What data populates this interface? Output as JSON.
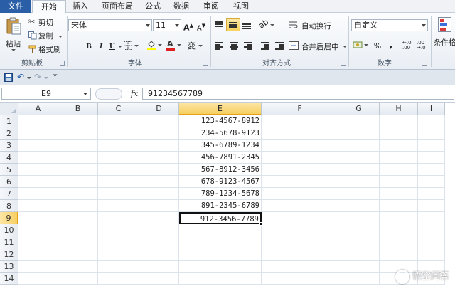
{
  "tabs": {
    "file": "文件",
    "home": "开始",
    "insert": "插入",
    "layout": "页面布局",
    "formula": "公式",
    "data": "数据",
    "review": "审阅",
    "view": "视图"
  },
  "ribbon": {
    "clipboard": {
      "paste": "粘贴",
      "cut": "剪切",
      "copy": "复制",
      "format_painter": "格式刷",
      "label": "剪贴板"
    },
    "font": {
      "font_name": "宋体",
      "font_size": "11",
      "bold": "B",
      "italic": "I",
      "underline": "U",
      "grow": "A",
      "shrink": "A",
      "label": "字体",
      "highlight_color": "#ffff00",
      "font_color": "#e02020"
    },
    "alignment": {
      "wrap_text": "自动换行",
      "merge_center": "合并后居中",
      "label": "对齐方式"
    },
    "number": {
      "format": "自定义",
      "percent": "%",
      "comma": ",",
      "label": "数字"
    },
    "styles": {
      "conditional": "条件格"
    }
  },
  "formula_bar": {
    "name_box": "E9",
    "fx": "fx",
    "value": "91234567789"
  },
  "grid": {
    "columns": [
      "A",
      "B",
      "C",
      "D",
      "E",
      "F",
      "G",
      "H",
      "I"
    ],
    "rows": [
      "1",
      "2",
      "3",
      "4",
      "5",
      "6",
      "7",
      "8",
      "9",
      "10",
      "11",
      "12",
      "13",
      "14"
    ],
    "selected_column": "E",
    "selected_row": "9",
    "column_e_values": [
      "123-4567-8912",
      "234-5678-9123",
      "345-6789-1234",
      "456-7891-2345",
      "567-8912-3456",
      "678-9123-4567",
      "789-1234-5678",
      "891-2345-6789",
      "912-3456-7789"
    ]
  },
  "watermark": {
    "text": "悟空问答"
  },
  "colors": {
    "file_tab": "#2a5fa8",
    "selection_header": "#f6cf62",
    "selection_accent": "#e3a21a"
  }
}
